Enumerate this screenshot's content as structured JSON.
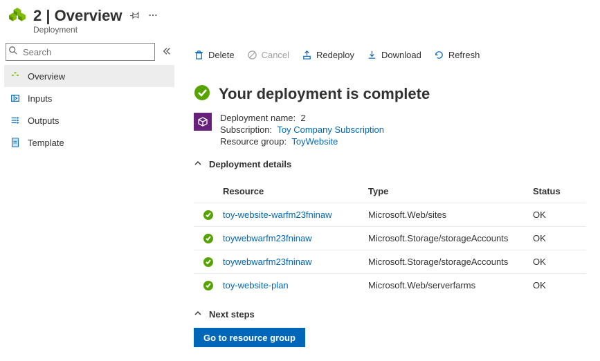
{
  "header": {
    "title": "2 | Overview",
    "subtitle": "Deployment"
  },
  "sidebar": {
    "search_placeholder": "Search",
    "items": [
      {
        "label": "Overview"
      },
      {
        "label": "Inputs"
      },
      {
        "label": "Outputs"
      },
      {
        "label": "Template"
      }
    ]
  },
  "toolbar": {
    "delete": "Delete",
    "cancel": "Cancel",
    "redeploy": "Redeploy",
    "download": "Download",
    "refresh": "Refresh"
  },
  "status": {
    "headline": "Your deployment is complete"
  },
  "meta": {
    "name_label": "Deployment name:",
    "name_value": "2",
    "sub_label": "Subscription:",
    "sub_value": "Toy Company Subscription",
    "rg_label": "Resource group:",
    "rg_value": "ToyWebsite"
  },
  "details": {
    "title": "Deployment details",
    "columns": {
      "resource": "Resource",
      "type": "Type",
      "status": "Status"
    },
    "rows": [
      {
        "resource": "toy-website-warfm23fninaw",
        "type": "Microsoft.Web/sites",
        "status": "OK"
      },
      {
        "resource": "toywebwarfm23fninaw",
        "type": "Microsoft.Storage/storageAccounts",
        "status": "OK"
      },
      {
        "resource": "toywebwarfm23fninaw",
        "type": "Microsoft.Storage/storageAccounts",
        "status": "OK"
      },
      {
        "resource": "toy-website-plan",
        "type": "Microsoft.Web/serverfarms",
        "status": "OK"
      }
    ]
  },
  "next": {
    "title": "Next steps",
    "cta": "Go to resource group"
  }
}
